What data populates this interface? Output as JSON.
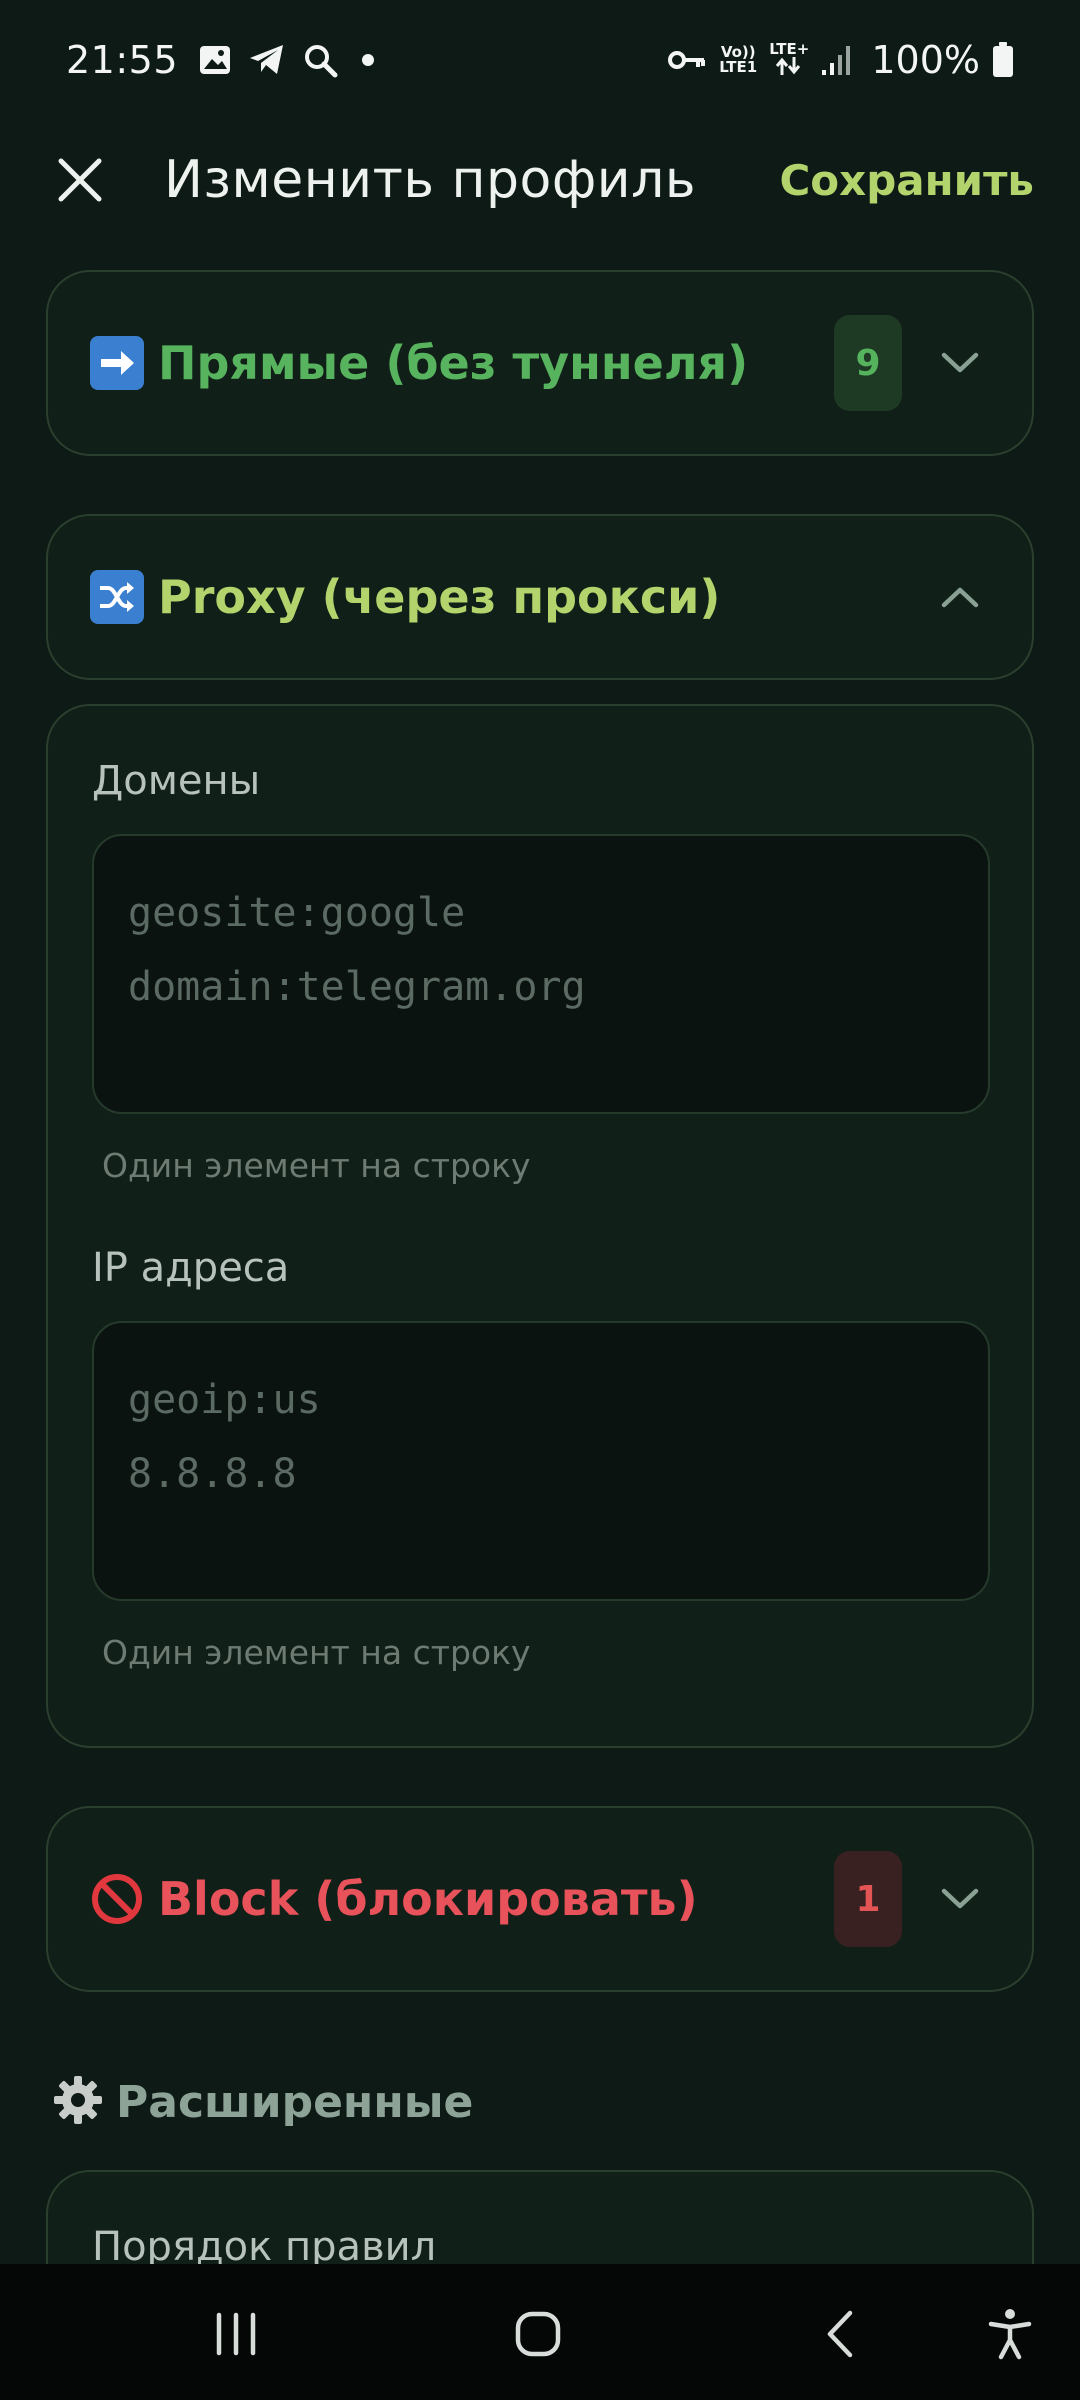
{
  "status_bar": {
    "time": "21:55",
    "net_top": "Vo))",
    "net_bottom": "LTE1",
    "lte_top": "LTE+",
    "battery": "100%",
    "left_icons": [
      "gallery-icon",
      "telegram-icon",
      "search-icon",
      "dot-icon"
    ],
    "right_icons": [
      "vpn-key-icon",
      "volte-icon",
      "lte-data-icon",
      "signal-icon",
      "battery-icon"
    ]
  },
  "header": {
    "title": "Изменить профиль",
    "save_label": "Сохранить"
  },
  "sections": {
    "direct": {
      "emoji": "➡️",
      "title": "Прямые (без туннеля)",
      "count": "9"
    },
    "proxy": {
      "emoji": "🔀",
      "title": "Proxy (через прокси)"
    },
    "block": {
      "emoji": "🚫",
      "title": "Block (блокировать)",
      "count": "1"
    }
  },
  "proxy_panel": {
    "domains_label": "Домены",
    "domains_placeholder": "geosite:google\ndomain:telegram.org",
    "domains_helper": "Один элемент на строку",
    "ip_label": "IP адреса",
    "ip_placeholder": "geoip:us\n8.8.8.8",
    "ip_helper": "Один элемент на строку"
  },
  "advanced": {
    "emoji": "⚙️",
    "title": "Расширенные",
    "rule_order_label": "Порядок правил"
  },
  "colors": {
    "background": "#0d1a15",
    "accent": "#b3d36c",
    "direct_green": "#57b35d",
    "block_red": "#e8525a"
  }
}
